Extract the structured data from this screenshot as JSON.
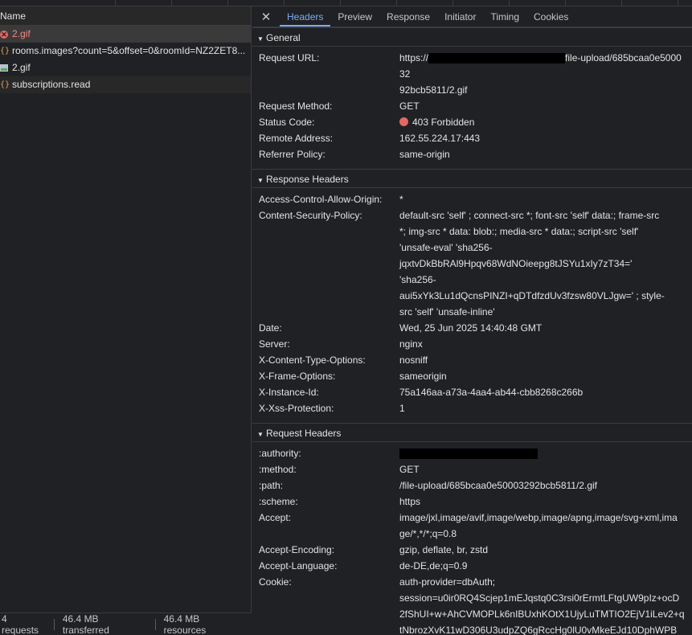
{
  "left_pane": {
    "column_header": "Name",
    "requests": [
      {
        "name": "2.gif",
        "icon": "error-icon",
        "status": "error"
      },
      {
        "name": "rooms.images?count=5&offset=0&roomId=NZ2ZET8...",
        "icon": "xhr-icon",
        "status": "ok"
      },
      {
        "name": "2.gif",
        "icon": "image-icon",
        "status": "ok"
      },
      {
        "name": "subscriptions.read",
        "icon": "xhr-icon",
        "status": "ok"
      }
    ],
    "status_bar": {
      "requests": "4 requests",
      "transferred": "46.4 MB transferred",
      "resources": "46.4 MB resources"
    }
  },
  "tabs": {
    "close_icon": "close-icon",
    "items": [
      "Headers",
      "Preview",
      "Response",
      "Initiator",
      "Timing",
      "Cookies"
    ],
    "active": "Headers"
  },
  "general": {
    "title": "General",
    "rows": [
      {
        "key": "Request URL:",
        "value_line1": "https://",
        "value_line1_tail": "file-upload/685bcaa0e500032",
        "value_line2": "92bcb5811/2.gif"
      },
      {
        "key": "Request Method:",
        "value": "GET"
      },
      {
        "key": "Status Code:",
        "value": "403 Forbidden",
        "status_color": "#e46962"
      },
      {
        "key": "Remote Address:",
        "value": "162.55.224.17:443"
      },
      {
        "key": "Referrer Policy:",
        "value": "same-origin"
      }
    ]
  },
  "response_headers": {
    "title": "Response Headers",
    "rows": [
      {
        "key": "Access-Control-Allow-Origin:",
        "lines": [
          "*"
        ]
      },
      {
        "key": "Content-Security-Policy:",
        "lines": [
          "default-src 'self' ; connect-src *; font-src 'self' data:; frame-src",
          "*; img-src * data: blob:; media-src * data:; script-src 'self'",
          "'unsafe-eval' 'sha256-",
          "jqxtvDkBbRAl9Hpqv68WdNOieepg8tJSYu1xIy7zT34='",
          "'sha256-",
          "aui5xYk3Lu1dQcnsPINZI+qDTdfzdUv3fzsw80VLJgw=' ; style-",
          "src 'self' 'unsafe-inline'"
        ]
      },
      {
        "key": "Date:",
        "lines": [
          "Wed, 25 Jun 2025 14:40:48 GMT"
        ]
      },
      {
        "key": "Server:",
        "lines": [
          "nginx"
        ]
      },
      {
        "key": "X-Content-Type-Options:",
        "lines": [
          "nosniff"
        ]
      },
      {
        "key": "X-Frame-Options:",
        "lines": [
          "sameorigin"
        ]
      },
      {
        "key": "X-Instance-Id:",
        "lines": [
          "75a146aa-a73a-4aa4-ab44-cbb8268c266b"
        ]
      },
      {
        "key": "X-Xss-Protection:",
        "lines": [
          "1"
        ]
      }
    ]
  },
  "request_headers": {
    "title": "Request Headers",
    "rows": [
      {
        "key": ":authority:",
        "lines": [],
        "redacted": true
      },
      {
        "key": ":method:",
        "lines": [
          "GET"
        ]
      },
      {
        "key": ":path:",
        "lines": [
          "/file-upload/685bcaa0e50003292bcb5811/2.gif"
        ]
      },
      {
        "key": ":scheme:",
        "lines": [
          "https"
        ]
      },
      {
        "key": "Accept:",
        "lines": [
          "image/jxl,image/avif,image/webp,image/apng,image/svg+xml,ima",
          "ge/*,*/*;q=0.8"
        ]
      },
      {
        "key": "Accept-Encoding:",
        "lines": [
          "gzip, deflate, br, zstd"
        ]
      },
      {
        "key": "Accept-Language:",
        "lines": [
          "de-DE,de;q=0.9"
        ]
      },
      {
        "key": "Cookie:",
        "lines": [
          "auth-provider=dbAuth;",
          "session=u0ir0RQ4Scjep1mEJqstq0C3rsi0rErmtLFtgUW9pIz+ocD",
          "2fShUI+w+AhCVMOPLk6nIBUxhKOtX1UjyLuTMTIO2EjV1iLev2+q",
          "tNbrozXvK11wD306U3udpZQ6gRccHg0lU0vMkeEJd10DphWPB"
        ]
      }
    ]
  }
}
